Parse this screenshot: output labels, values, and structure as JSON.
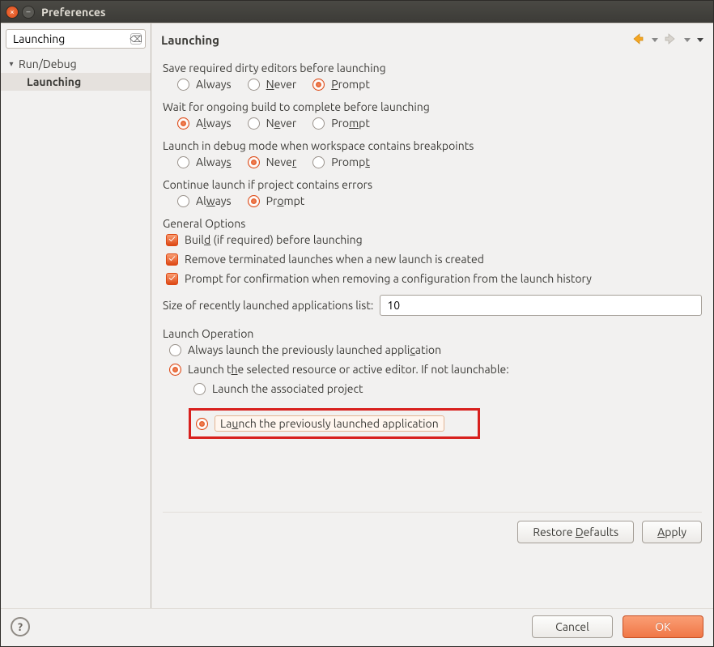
{
  "window": {
    "title": "Preferences"
  },
  "sidebar": {
    "filter_value": "Launching",
    "tree": [
      {
        "label": "Run/Debug",
        "expanded": true
      },
      {
        "label": "Launching",
        "selected": true
      }
    ]
  },
  "header": {
    "page_title": "Launching"
  },
  "sections": {
    "save_editors": {
      "label": "Save required dirty editors before launching",
      "options": {
        "always": "Always",
        "never": "Never",
        "prompt": "Prompt"
      },
      "selected": "prompt"
    },
    "wait_build": {
      "label": "Wait for ongoing build to complete before launching",
      "options": {
        "always": "Always",
        "never": "Never",
        "prompt": "Prompt"
      },
      "selected": "always"
    },
    "debug_breakpoints": {
      "label": "Launch in debug mode when workspace contains breakpoints",
      "options": {
        "always": "Always",
        "never": "Never",
        "prompt": "Prompt"
      },
      "selected": "never"
    },
    "continue_errors": {
      "label": "Continue launch if project contains errors",
      "options": {
        "always": "Always",
        "prompt": "Prompt"
      },
      "selected": "prompt"
    },
    "general": {
      "label": "General Options",
      "build_before": "Build (if required) before launching",
      "remove_terminated": "Remove terminated launches when a new launch is created",
      "prompt_remove_history": "Prompt for confirmation when removing a configuration from the launch history",
      "recent_list_label": "Size of recently launched applications list:",
      "recent_list_value": "10"
    },
    "launch_op": {
      "label": "Launch Operation",
      "always_prev": "Always launch the previously launched application",
      "launch_selected": "Launch the selected resource or active editor. If not launchable:",
      "assoc_project": "Launch the associated project",
      "prev_app": "Launch the previously launched application"
    }
  },
  "buttons": {
    "restore_defaults": "Restore Defaults",
    "apply": "Apply",
    "cancel": "Cancel",
    "ok": "OK"
  }
}
